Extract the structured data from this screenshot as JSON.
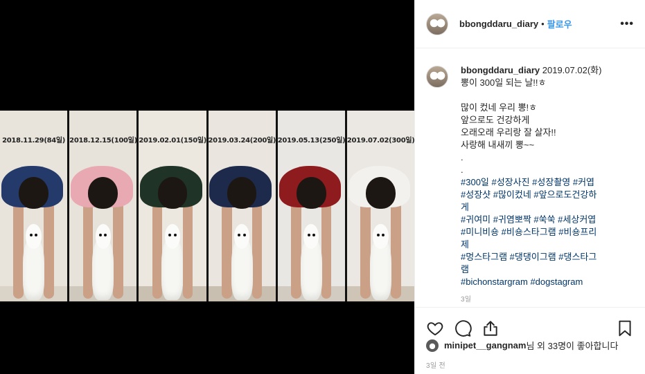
{
  "post": {
    "username": "bbongddaru_diary",
    "separator": "•",
    "follow_label": "팔로우",
    "more_label": "•••"
  },
  "media": {
    "panels": [
      {
        "date": "2018.11.29(84일)",
        "wall": "#e8e4dc",
        "floor": "#d9d3c8",
        "shirt": "#243a6b"
      },
      {
        "date": "2018.12.15(100일)",
        "wall": "#e7e2da",
        "floor": "#cfc8bc",
        "shirt": "#e9a9b2"
      },
      {
        "date": "2019.02.01(150일)",
        "wall": "#ece7df",
        "floor": "#c9c0b2",
        "shirt": "#1f3327"
      },
      {
        "date": "2019.03.24(200일)",
        "wall": "#eae6df",
        "floor": "#c8bfb0",
        "shirt": "#1d2a4c"
      },
      {
        "date": "2019.05.13(250일)",
        "wall": "#e9e7e4",
        "floor": "#d2cbc2",
        "shirt": "#8e1b1e"
      },
      {
        "date": "2019.07.02(300일)",
        "wall": "#ebe8e3",
        "floor": "#cec5b7",
        "shirt": "#f3f1ee"
      }
    ]
  },
  "caption": {
    "username": "bbongddaru_diary",
    "date_text": "2019.07.02(화)",
    "lines": [
      "뽕이 300일 되는 날!!ㅎ",
      "",
      "많이 컸네 우리 뽕!ㅎ",
      "앞으로도 건강하게",
      "오래오래 우리랑 잘 살자!!",
      "사랑해 내새끼 뽕~~",
      ".",
      "."
    ],
    "hashtags": [
      "#300일 #성장사진 #성장촬영 #커엽",
      "#성장샷 #많이컸네 #앞으로도건강하",
      "게",
      "#귀여미 #귀염뽀짝 #쑥쑥 #세상커엽",
      "#미니비숑 #비숑스타그램 #비숑프리",
      "제",
      "#멍스타그램 #댕댕이그램 #댕스타그",
      "램",
      "#bichonstargram #dogstagram"
    ],
    "time": "3일"
  },
  "actions": {
    "like_icon": "heart-icon",
    "comment_icon": "comment-icon",
    "share_icon": "share-icon",
    "save_icon": "bookmark-icon"
  },
  "likes": {
    "liker": "minipet__gangnam",
    "rest": "님 외 33명이 좋아합니다"
  },
  "posted_ago": "3일 전"
}
